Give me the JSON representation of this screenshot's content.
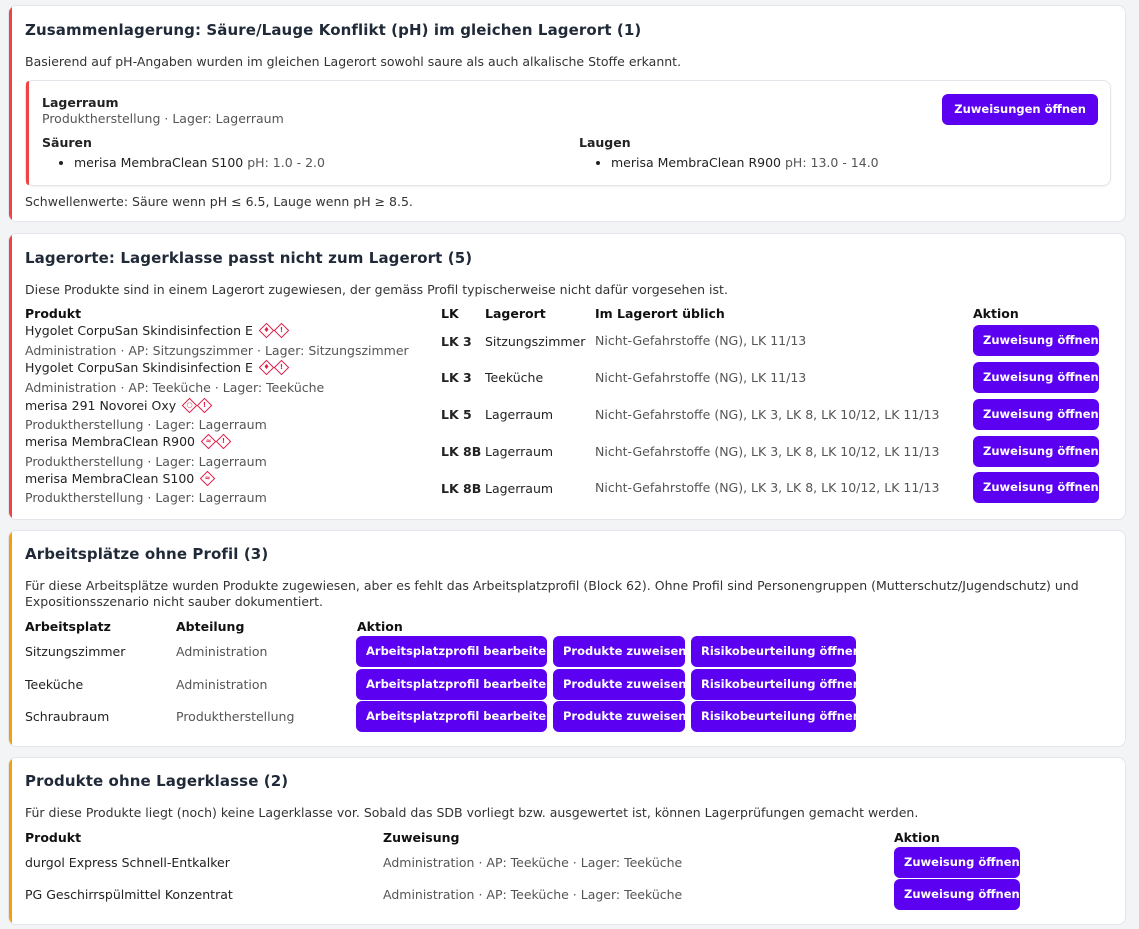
{
  "section1": {
    "title": "Zusammenlagerung: Säure/Lauge Konflikt (pH) im gleichen Lagerort (1)",
    "description": "Basierend auf pH-Angaben wurden im gleichen Lagerort sowohl saure als auch alkalische Stoffe erkannt.",
    "location_name": "Lagerraum",
    "location_sub": "Produktherstellung · Lager: Lagerraum",
    "button": "Zuweisungen öffnen",
    "acids_title": "Säuren",
    "acids": [
      {
        "name": "merisa MembraClean S100",
        "ph": "pH: 1.0 - 2.0"
      }
    ],
    "bases_title": "Laugen",
    "bases": [
      {
        "name": "merisa MembraClean R900",
        "ph": "pH: 13.0 - 14.0"
      }
    ],
    "thresholds": "Schwellenwerte: Säure wenn pH ≤ 6.5, Lauge wenn pH ≥ 8.5."
  },
  "section2": {
    "title": "Lagerorte: Lagerklasse passt nicht zum Lagerort (5)",
    "description": "Diese Produkte sind in einem Lagerort zugewiesen, der gemäss Profil typischerweise nicht dafür vorgesehen ist.",
    "headers": {
      "product": "Produkt",
      "lk": "LK",
      "location": "Lagerort",
      "usual": "Im Lagerort üblich",
      "action": "Aktion"
    },
    "rows": [
      {
        "product": "Hygolet CorpuSan Skindisinfection E",
        "sub": "Administration · AP: Sitzungszimmer · Lager: Sitzungszimmer",
        "lk": "LK 3",
        "location": "Sitzungszimmer",
        "usual": "Nicht-Gefahrstoffe (NG), LK 11/13",
        "button": "Zuweisung öffnen",
        "icons": [
          "flame-icon",
          "exclamation-icon"
        ]
      },
      {
        "product": "Hygolet CorpuSan Skindisinfection E",
        "sub": "Administration · AP: Teeküche · Lager: Teeküche",
        "lk": "LK 3",
        "location": "Teeküche",
        "usual": "Nicht-Gefahrstoffe (NG), LK 11/13",
        "button": "Zuweisung öffnen",
        "icons": [
          "flame-icon",
          "exclamation-icon"
        ]
      },
      {
        "product": "merisa 291 Novorei Oxy",
        "sub": "Produktherstellung · Lager: Lagerraum",
        "lk": "LK 5",
        "location": "Lagerraum",
        "usual": "Nicht-Gefahrstoffe (NG), LK 3, LK 8, LK 10/12, LK 11/13",
        "button": "Zuweisung öffnen",
        "icons": [
          "oxidizer-icon",
          "exclamation-icon"
        ]
      },
      {
        "product": "merisa MembraClean R900",
        "sub": "Produktherstellung · Lager: Lagerraum",
        "lk": "LK 8B",
        "location": "Lagerraum",
        "usual": "Nicht-Gefahrstoffe (NG), LK 3, LK 8, LK 10/12, LK 11/13",
        "button": "Zuweisung öffnen",
        "icons": [
          "corrosive-icon",
          "exclamation-icon"
        ]
      },
      {
        "product": "merisa MembraClean S100",
        "sub": "Produktherstellung · Lager: Lagerraum",
        "lk": "LK 8B",
        "location": "Lagerraum",
        "usual": "Nicht-Gefahrstoffe (NG), LK 3, LK 8, LK 10/12, LK 11/13",
        "button": "Zuweisung öffnen",
        "icons": [
          "corrosive-icon"
        ]
      }
    ]
  },
  "section3": {
    "title": "Arbeitsplätze ohne Profil (3)",
    "description": "Für diese Arbeitsplätze wurden Produkte zugewiesen, aber es fehlt das Arbeitsplatzprofil (Block 62). Ohne Profil sind Personengruppen (Mutterschutz/Jugendschutz) und Expositionsszenario nicht sauber dokumentiert.",
    "headers": {
      "workplace": "Arbeitsplatz",
      "department": "Abteilung",
      "action": "Aktion"
    },
    "buttons": {
      "profile": "Arbeitsplatzprofil bearbeiten",
      "assign": "Produkte zuweisen",
      "risk": "Risikobeurteilung öffnen"
    },
    "rows": [
      {
        "workplace": "Sitzungszimmer",
        "department": "Administration"
      },
      {
        "workplace": "Teeküche",
        "department": "Administration"
      },
      {
        "workplace": "Schraubraum",
        "department": "Produktherstellung"
      }
    ]
  },
  "section4": {
    "title": "Produkte ohne Lagerklasse (2)",
    "description": "Für diese Produkte liegt (noch) keine Lagerklasse vor. Sobald das SDB vorliegt bzw. ausgewertet ist, können Lagerprüfungen gemacht werden.",
    "headers": {
      "product": "Produkt",
      "assignment": "Zuweisung",
      "action": "Aktion"
    },
    "rows": [
      {
        "product": "durgol Express Schnell-Entkalker",
        "assignment": "Administration · AP: Teeküche · Lager: Teeküche",
        "button": "Zuweisung öffnen"
      },
      {
        "product": "PG Geschirrspülmittel Konzentrat",
        "assignment": "Administration · AP: Teeküche · Lager: Teeküche",
        "button": "Zuweisung öffnen"
      }
    ]
  },
  "colors": {
    "accent": "#5b00f0",
    "danger": "#ef4444",
    "warning": "#f59e0b"
  }
}
